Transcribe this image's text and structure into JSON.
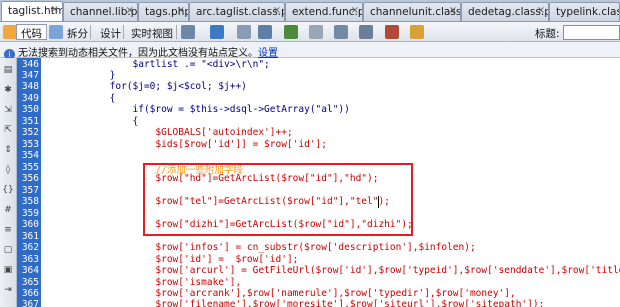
{
  "tabs": [
    {
      "label": "taglist.htm*",
      "active": true
    },
    {
      "label": "channel.lib.php",
      "active": false
    },
    {
      "label": "tags.php",
      "active": false
    },
    {
      "label": "arc.taglist.class.php",
      "active": false
    },
    {
      "label": "extend.func.php",
      "active": false
    },
    {
      "label": "channelunit.class.php",
      "active": false
    },
    {
      "label": "dedetag.class.php",
      "active": false
    },
    {
      "label": "typelink.class.php",
      "active": false
    }
  ],
  "tab_close_glyph": "×",
  "toolbar": {
    "code_label": "代码",
    "split_label": "拆分",
    "design_label": "设计",
    "liveview_label": "实时视图",
    "title_label": "标题:",
    "title_value": ""
  },
  "infobar": {
    "message": "无法搜索到动态相关文件，因为此文档没有站点定义。",
    "link": "设置"
  },
  "line_numbers": [
    "346",
    "347",
    "348",
    "349",
    "350",
    "351",
    "352",
    "353",
    "354",
    "355",
    "356",
    "357",
    "358",
    "359",
    "360",
    "361",
    "362",
    "363",
    "364",
    "365",
    "366",
    "367"
  ],
  "code_lines": [
    "                $artlist .= \"<div>\\r\\n\";",
    "            }",
    "            for($j=0; $j<$col; $j++)",
    "            {",
    "                if($row = $this->dsql->GetArray(\"al\"))",
    "                {",
    "                    $GLOBALS['autoindex']++;",
    "                    $ids[$row['id']] = $row['id'];",
    "",
    "                    //添加一些附加字段",
    "                    $row[\"hd\"]=GetArcList($row[\"id\"],\"hd\");",
    "",
    "                    $row[\"tel\"]=GetArcList($row[\"id\"],\"tel\");",
    "",
    "                    $row[\"dizhi\"]=GetArcList($row[\"id\"],\"dizhi\");",
    "",
    "                    $row['infos'] = cn_substr($row['description'],$infolen);",
    "                    $row['id'] =  $row['id'];",
    "                    $row['arcurl'] = GetFileUrl($row['id'],$row['typeid'],$row['senddate'],$row['title'],",
    "                    $row['ismake'],",
    "                    $row['arcrank'],$row['namerule'],$row['typedir'],$row['money'],",
    "                    $row['filename'],$row['moresite'],$row['siteurl'],$row['sitepath']);"
  ],
  "colors": {
    "gutter": "#2f6bc7",
    "code_text": "#000080",
    "string_text": "#cc0000",
    "comment_text": "#ff9900",
    "highlight_box": "#e02020"
  }
}
